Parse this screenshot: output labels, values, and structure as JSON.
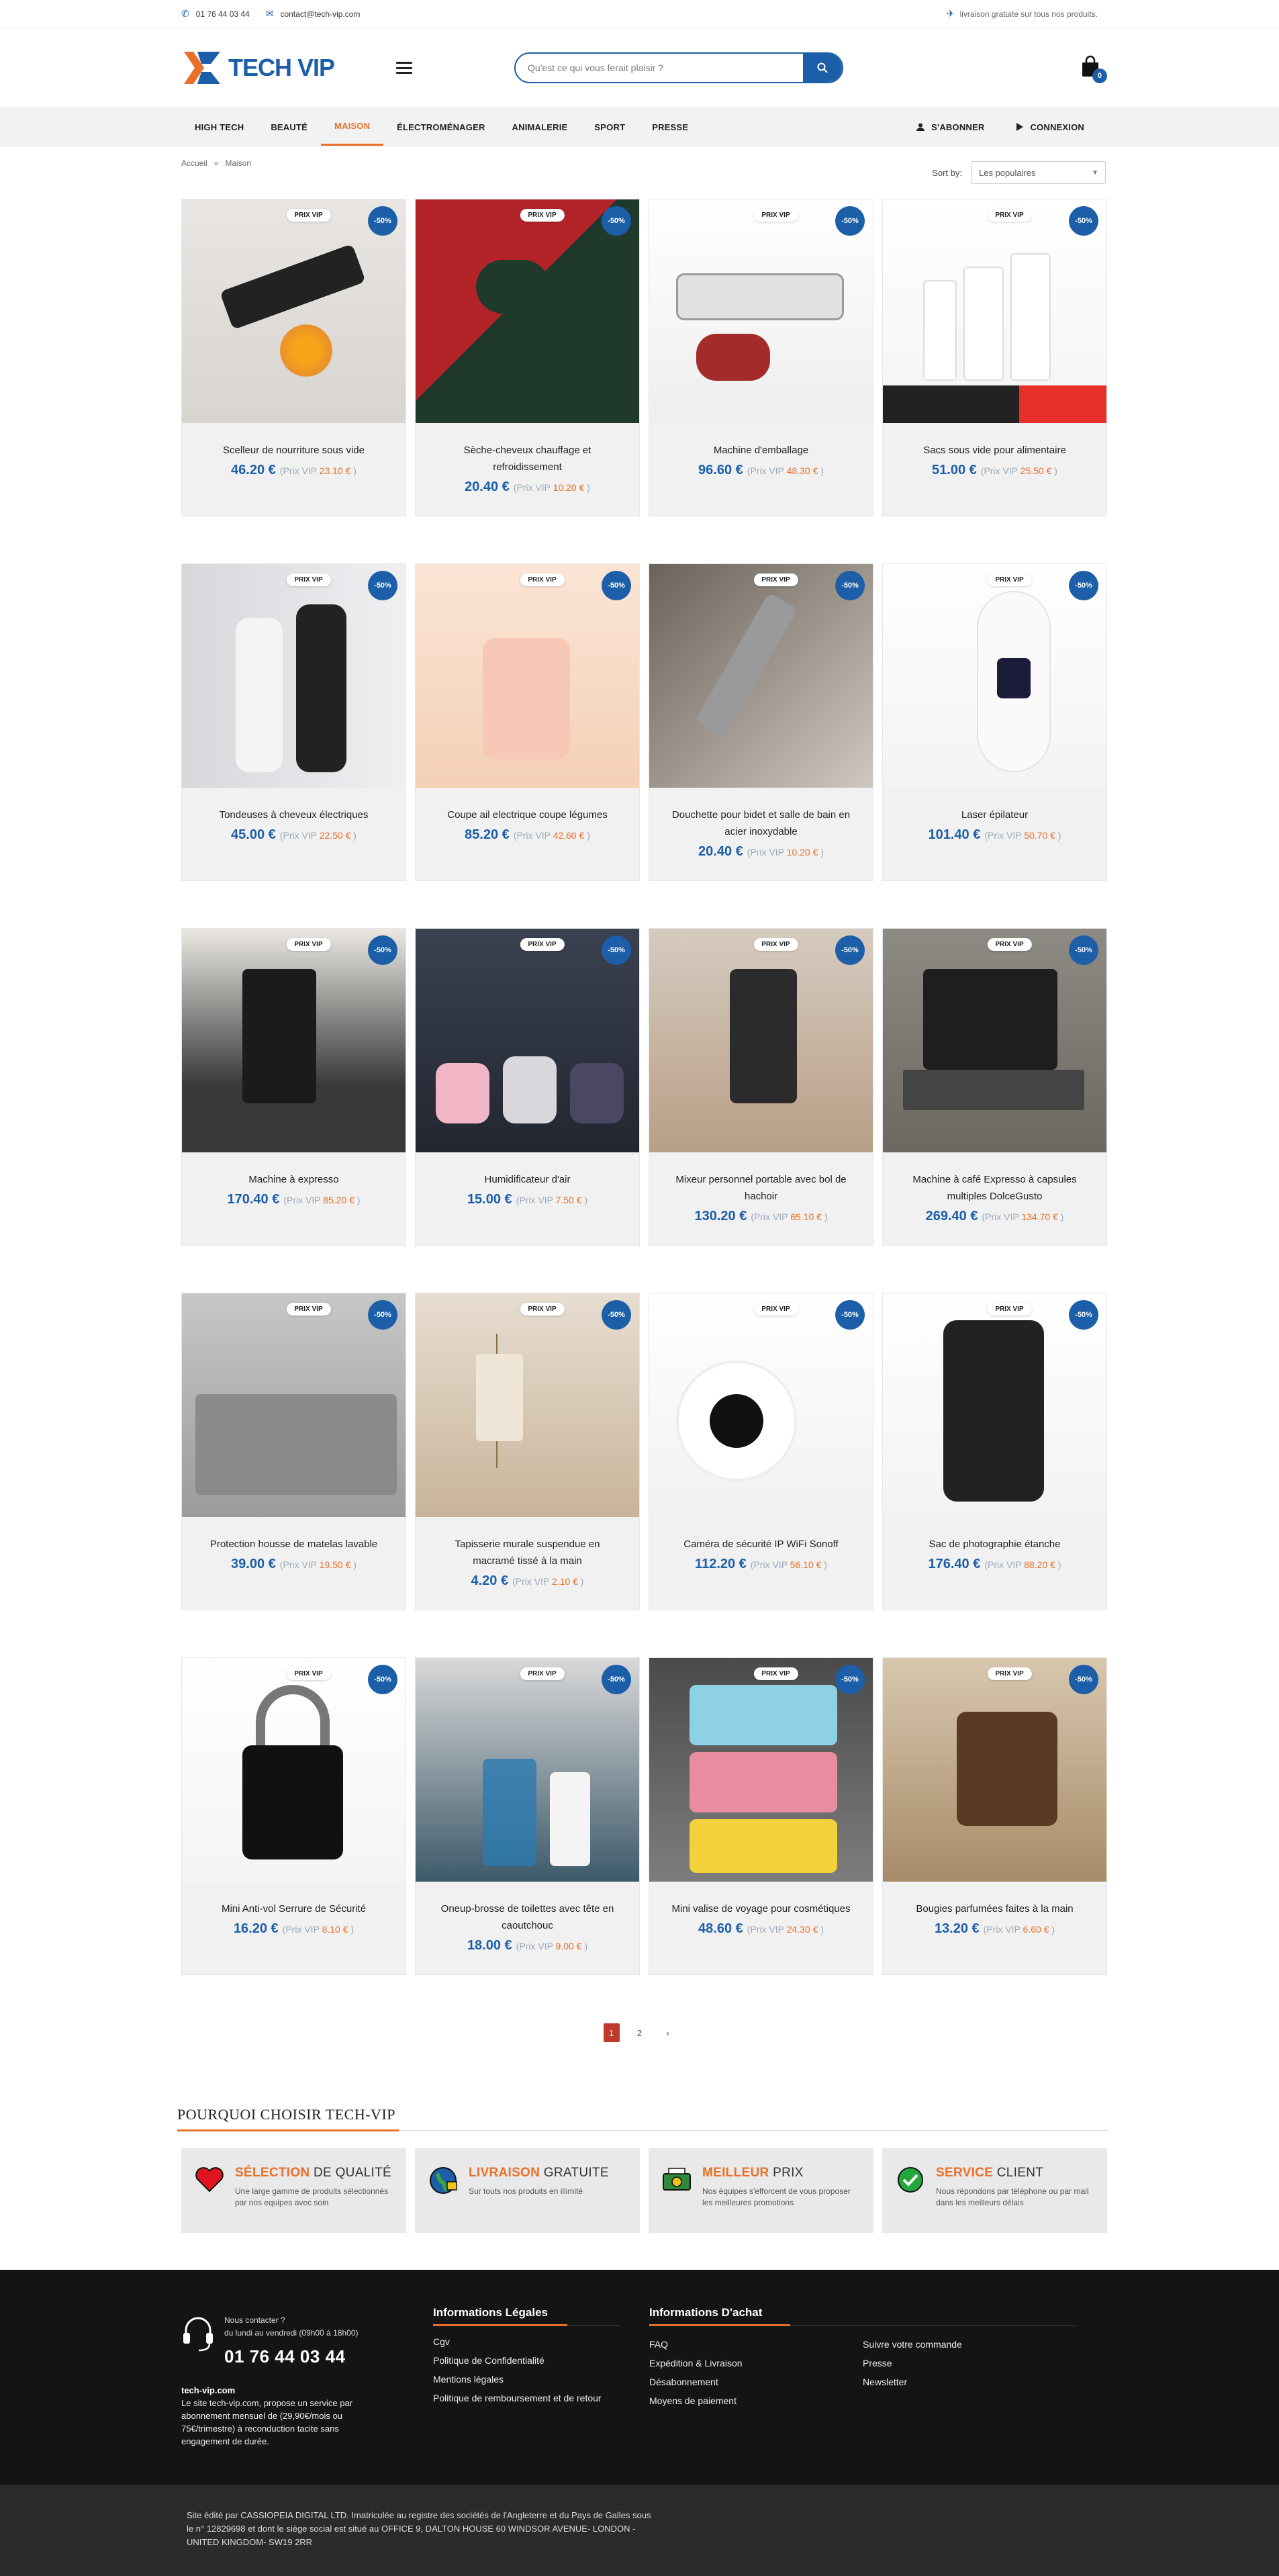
{
  "topbar": {
    "phone": "01 76 44 03 44",
    "email": "contact@tech-vip.com",
    "shipping": "livraison gratuite sur tous nos produits."
  },
  "header": {
    "logo_text": "TECH VIP",
    "search_placeholder": "Qu'est ce qui vous ferait plaisir ?",
    "cart_count": "0"
  },
  "nav": {
    "items": [
      "HIGH TECH",
      "BEAUTÉ",
      "MAISON",
      "ÉLECTROMÉNAGER",
      "ANIMALERIE",
      "SPORT",
      "PRESSE"
    ],
    "subscribe": "S'ABONNER",
    "login": "CONNEXION"
  },
  "breadcrumb": {
    "home": "Accueil",
    "sep": "»",
    "current": "Maison"
  },
  "sort": {
    "label": "Sort by:",
    "value": "Les populaires"
  },
  "badges": {
    "vip": "PRIX VIP",
    "discount": "-50%",
    "vip_label": "Prix VIP"
  },
  "products": [
    {
      "name": "Scelleur de nourriture sous vide",
      "price": "46.20 €",
      "vip": "23.10 €"
    },
    {
      "name": "Sèche-cheveux chauffage et refroidissement",
      "price": "20.40 €",
      "vip": "10.20 €"
    },
    {
      "name": "Machine d'emballage",
      "price": "96.60 €",
      "vip": "48.30 €"
    },
    {
      "name": "Sacs sous vide pour alimentaire",
      "price": "51.00 €",
      "vip": "25.50 €"
    },
    {
      "name": "Tondeuses à cheveux électriques",
      "price": "45.00 €",
      "vip": "22.50 €"
    },
    {
      "name": "Coupe ail electrique coupe légumes",
      "price": "85.20 €",
      "vip": "42.60 €"
    },
    {
      "name": "Douchette pour bidet et salle de bain en acier inoxydable",
      "price": "20.40 €",
      "vip": "10.20 €"
    },
    {
      "name": "Laser épilateur",
      "price": "101.40 €",
      "vip": "50.70 €"
    },
    {
      "name": "Machine à expresso",
      "price": "170.40 €",
      "vip": "85.20 €"
    },
    {
      "name": "Humidificateur d'air",
      "price": "15.00 €",
      "vip": "7.50 €"
    },
    {
      "name": "Mixeur personnel portable avec bol de hachoir",
      "price": "130.20 €",
      "vip": "65.10 €"
    },
    {
      "name": "Machine à café Expresso à capsules multiples DolceGusto",
      "price": "269.40 €",
      "vip": "134.70 €"
    },
    {
      "name": "Protection housse de matelas lavable",
      "price": "39.00 €",
      "vip": "19.50 €"
    },
    {
      "name": "Tapisserie murale suspendue en macramé tissé à la main",
      "price": "4.20 €",
      "vip": "2.10 €"
    },
    {
      "name": "Caméra de sécurité IP WiFi Sonoff",
      "price": "112.20 €",
      "vip": "56.10 €"
    },
    {
      "name": "Sac de photographie étanche",
      "price": "176.40 €",
      "vip": "88.20 €"
    },
    {
      "name": "Mini Anti-vol Serrure de Sécurité",
      "price": "16.20 €",
      "vip": "8.10 €"
    },
    {
      "name": "Oneup-brosse de toilettes avec tête en caoutchouc",
      "price": "18.00 €",
      "vip": "9.00 €"
    },
    {
      "name": "Mini valise de voyage pour cosmétiques",
      "price": "48.60 €",
      "vip": "24.30 €"
    },
    {
      "name": "Bougies parfumées faites à la main",
      "price": "13.20 €",
      "vip": "6.60 €"
    }
  ],
  "pager": {
    "pages": [
      "1",
      "2"
    ],
    "next": "›"
  },
  "why": {
    "title_a": "POURQUOI CHOISIR",
    "title_b": "TECH-VIP",
    "features": [
      {
        "hl": "SÉLECTION",
        "rest": "DE QUALITÉ",
        "desc": "Une large gamme de produits sélectionnés par nos equipes avec soin"
      },
      {
        "hl": "LIVRAISON",
        "rest": "GRATUITE",
        "desc": "Sur touts nos produits en illimité"
      },
      {
        "hl": "MEILLEUR",
        "rest": "PRIX",
        "desc": "Nos équipes s'efforcent de vous proposer les meilleures promotions"
      },
      {
        "hl": "SERVICE",
        "rest": "CLIENT",
        "desc": "Nous répondons par téléphone ou par mail dans les meilleurs délais"
      }
    ]
  },
  "footer": {
    "contact_label": "Nous contacter ?",
    "hours": "du lundi au vendredi (09h00 à 18h00)",
    "phone": "01 76 44 03 44",
    "site": "tech-vip.com",
    "about": "Le site tech-vip.com, propose un service par abonnement mensuel de (29,90€/mois ou 75€/trimestre) à reconduction tacite sans engagement de durée.",
    "legal_title": "Informations Légales",
    "legal_links": [
      "Cgv",
      "Politique de Confidentialité",
      "Mentions légales",
      "Politique de remboursement et de retour"
    ],
    "achat_title": "Informations D'achat",
    "achat_links": [
      "FAQ",
      "Expédition & Livraison",
      "Désabonnement",
      "Moyens de paiement",
      "Suivre votre commande",
      "Presse",
      "Newsletter"
    ],
    "bottom_text": "Site édité par CASSIOPEIA DIGITAL LTD. Imatriculée au registre des sociétés de l'Angleterre et du Pays de Galles sous le n° 12829698 et dont le siège social est situé au OFFICE 9, DALTON HOUSE 60 WINDSOR AVENUE- LONDON - UNITED KINGDOM- SW19 2RR"
  },
  "colors": {
    "brand": "#1c5fa8",
    "accent": "#e8702a"
  }
}
